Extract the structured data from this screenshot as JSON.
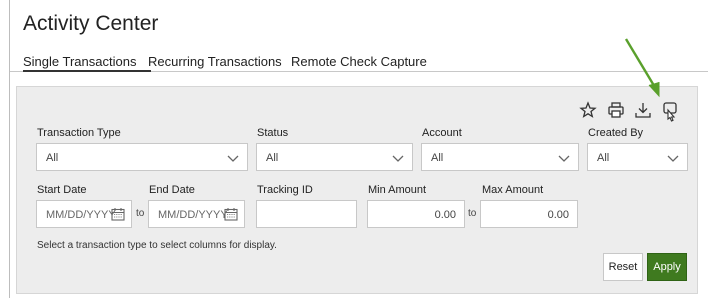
{
  "page": {
    "title": "Activity Center"
  },
  "tabs": [
    {
      "label": "Single Transactions"
    },
    {
      "label": "Recurring Transactions"
    },
    {
      "label": "Remote Check Capture"
    }
  ],
  "toolbar": {
    "icons": [
      "star-icon",
      "print-icon",
      "download-icon",
      "customize-columns-icon"
    ]
  },
  "filters": {
    "transaction_type": {
      "label": "Transaction Type",
      "value": "All"
    },
    "status": {
      "label": "Status",
      "value": "All"
    },
    "account": {
      "label": "Account",
      "value": "All"
    },
    "created_by": {
      "label": "Created By",
      "value": "All"
    },
    "start_date": {
      "label": "Start Date",
      "placeholder": "MM/DD/YYYY"
    },
    "end_date": {
      "label": "End Date",
      "placeholder": "MM/DD/YYYY"
    },
    "to_label": "to",
    "tracking_id": {
      "label": "Tracking ID",
      "value": ""
    },
    "min_amount": {
      "label": "Min Amount",
      "value": "0.00"
    },
    "max_amount": {
      "label": "Max Amount",
      "value": "0.00"
    },
    "amount_to_label": "to"
  },
  "hint": "Select a transaction type to select columns for display.",
  "actions": {
    "reset": "Reset",
    "apply": "Apply"
  },
  "colors": {
    "apply_bg": "#3f7a1f",
    "arrow": "#5aa02c"
  }
}
